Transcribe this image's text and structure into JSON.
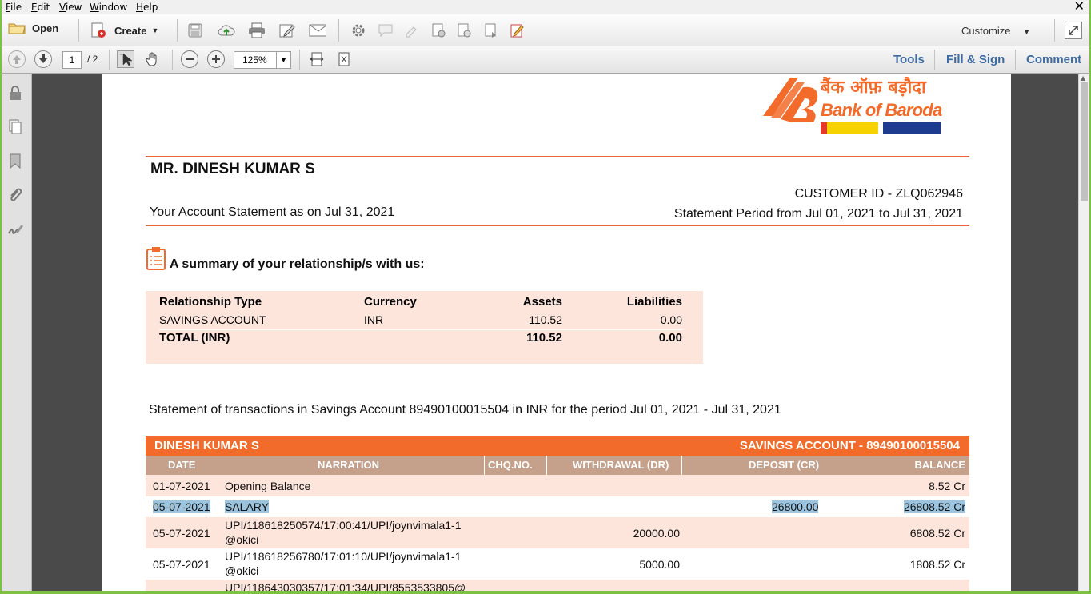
{
  "menu": [
    "File",
    "Edit",
    "View",
    "Window",
    "Help"
  ],
  "toolbar": {
    "open_label": "Open",
    "create_label": "Create",
    "customize_label": "Customize",
    "page_current": "1",
    "page_total": "/ 2",
    "zoom": "125%",
    "tools_label": "Tools",
    "fill_sign_label": "Fill & Sign",
    "comment_label": "Comment"
  },
  "bank": {
    "name_hindi": "बैंक ऑफ़ बड़ौदा",
    "name": "Bank of Baroda",
    "brand_color": "#f26b2a"
  },
  "header": {
    "customer_name": "MR. DINESH KUMAR S",
    "customer_id": "CUSTOMER ID - ZLQ062946",
    "statement_as_on": "Your Account Statement as on Jul 31, 2021",
    "statement_period": "Statement Period from Jul 01, 2021 to Jul 31, 2021"
  },
  "summary": {
    "heading": "A summary of your relationship/s with us:",
    "columns": [
      "Relationship Type",
      "Currency",
      "Assets",
      "Liabilities"
    ],
    "rows": [
      {
        "type": "SAVINGS ACCOUNT",
        "currency": "INR",
        "assets": "110.52",
        "liabilities": "0.00"
      }
    ],
    "total": {
      "label": "TOTAL (INR)",
      "assets": "110.52",
      "liabilities": "0.00"
    }
  },
  "transactions": {
    "intro": "Statement of transactions in Savings Account 89490100015504 in INR for the period  Jul 01, 2021 - Jul 31, 2021",
    "holder": "DINESH KUMAR S",
    "account_label": "SAVINGS ACCOUNT - 89490100015504",
    "columns": [
      "DATE",
      "NARRATION",
      "CHQ.NO.",
      "WITHDRAWAL (DR)",
      "DEPOSIT (CR)",
      "BALANCE"
    ],
    "rows": [
      {
        "date": "01-07-2021",
        "narration": "Opening Balance",
        "narration2": "",
        "withdrawal": "",
        "deposit": "",
        "balance": "8.52 Cr"
      },
      {
        "date": "05-07-2021",
        "narration": "SALARY",
        "narration2": "",
        "withdrawal": "",
        "deposit": "26800.00",
        "balance": "26808.52 Cr"
      },
      {
        "date": "05-07-2021",
        "narration": "UPI/118618250574/17:00:41/UPI/joynvimala1-1",
        "narration2": "@okici",
        "withdrawal": "20000.00",
        "deposit": "",
        "balance": "6808.52 Cr"
      },
      {
        "date": "05-07-2021",
        "narration": "UPI/118618256780/17:01:10/UPI/joynvimala1-1",
        "narration2": "@okici",
        "withdrawal": "5000.00",
        "deposit": "",
        "balance": "1808.52 Cr"
      },
      {
        "date": "",
        "narration": "UPI/118643030357/17:01:34/UPI/8553533805@",
        "narration2": "",
        "withdrawal": "",
        "deposit": "",
        "balance": ""
      }
    ]
  }
}
